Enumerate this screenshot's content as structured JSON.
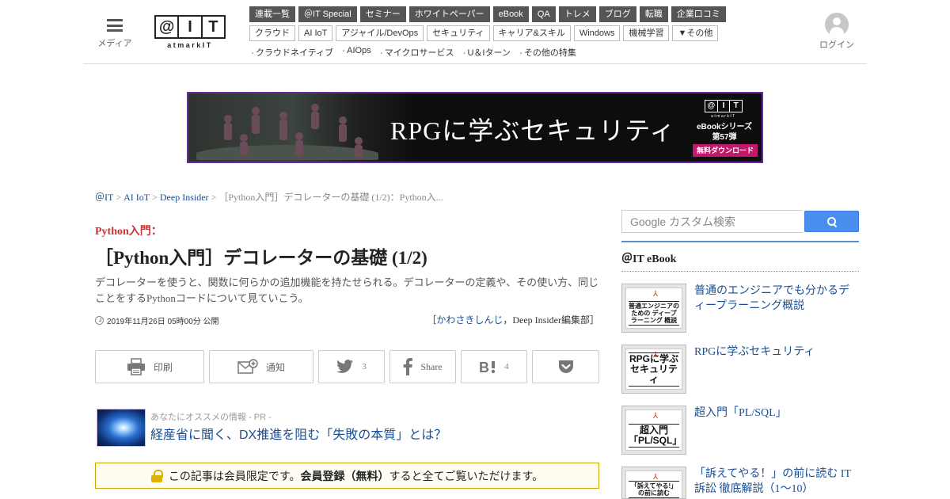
{
  "header": {
    "menu_label": "メディア",
    "logo": {
      "letters": [
        "@",
        "I",
        "T"
      ],
      "sub": "atmarkIT"
    },
    "nav_primary": [
      "連載一覧",
      "＠IT Special",
      "セミナー",
      "ホワイトペーパー",
      "eBook",
      "QA",
      "トレメ",
      "ブログ",
      "転職",
      "企業口コミ"
    ],
    "nav_secondary": [
      "クラウド",
      "AI IoT",
      "アジャイル/DevOps",
      "セキュリティ",
      "キャリア&スキル",
      "Windows",
      "機械学習",
      "▼その他"
    ],
    "nav_features": [
      "クラウドネイティブ",
      "AIOps",
      "マイクロサービス",
      "U＆Iターン",
      "その他の特集"
    ],
    "login_label": "ログイン"
  },
  "banner": {
    "title": "RPGに学ぶセキュリティ",
    "logo_letters": [
      "@",
      "I",
      "T"
    ],
    "logo_sub": "atmarkIT",
    "series_line1": "eBookシリーズ",
    "series_line2": "第57弾",
    "cta": "無料ダウンロード"
  },
  "breadcrumb": {
    "items": [
      "＠IT",
      "AI IoT",
      "Deep Insider"
    ],
    "current": "［Python入門］デコレーターの基礎 (1/2)：Python入..."
  },
  "article": {
    "kicker": "Python入門：",
    "title": "［Python入門］デコレーターの基礎 (1/2)",
    "lead": "デコレーターを使うと、関数に何らかの追加機能を持たせられる。デコレーターの定義や、その使い方、同じことをするPythonコードについて見ていこう。",
    "date": "2019年11月26日 05時00分 公開",
    "author_prefix": "［",
    "author_name": "かわさきしんじ",
    "author_suffix": "，Deep Insider編集部］"
  },
  "share": {
    "print_label": "印刷",
    "notify_label": "通知",
    "twitter_count": "3",
    "facebook_label": "Share",
    "hatena_count": "4"
  },
  "pr": {
    "label": "あなたにオススメの情報 - PR -",
    "title": "経産省に聞く、DX推進を阻む「失敗の本質」とは？"
  },
  "notice": {
    "before": "この記事は会員限定です。",
    "bold": "会員登録（無料）",
    "after": "すると全てご覧いただけます。"
  },
  "sidebar": {
    "search_placeholder": "Google カスタム検索",
    "heading": "＠IT eBook",
    "ebooks": [
      {
        "title": "普通のエンジニアでも分かるディープラーニング概説",
        "cover": "普通エンジニアのための ディープラーニング 概説"
      },
      {
        "title": "RPGに学ぶセキュリティ",
        "cover": "RPGに学ぶ セキュリティ"
      },
      {
        "title": "超入門「PL/SQL」",
        "cover": "超入門 「PL/SQL」"
      },
      {
        "title": "「訴えてやる！」の前に読む IT訴訟 徹底解説（1～10）",
        "cover": "「訴えてやる!」 の前に読む"
      }
    ]
  }
}
